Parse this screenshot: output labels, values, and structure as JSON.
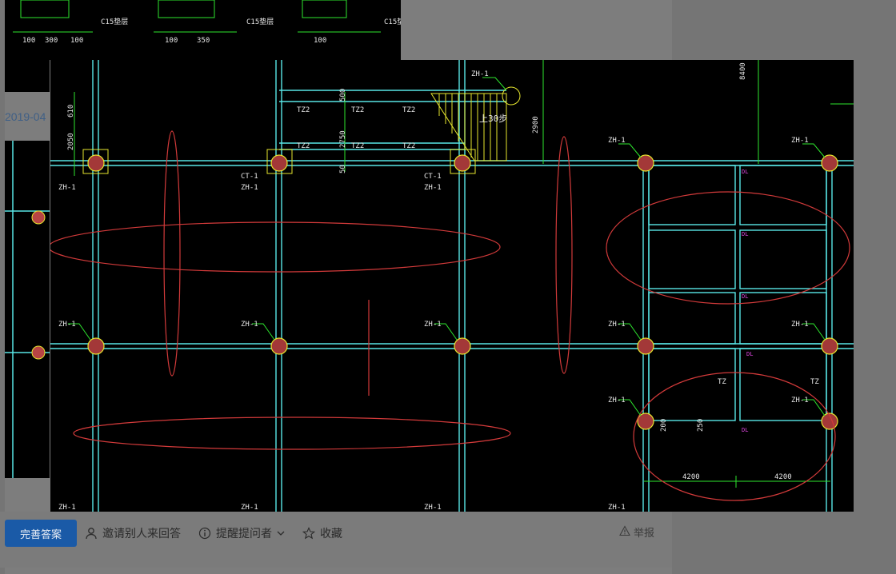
{
  "date_text": "2019-04",
  "actions": {
    "improve_answer": "完善答案",
    "invite_label": "邀请别人来回答",
    "remind_label": "提醒提问者",
    "favorite_label": "收藏",
    "report_label": "举报"
  },
  "drawing": {
    "labels": {
      "zh1": "ZH-1",
      "ct1": "CT-1",
      "tz2": "TZ2",
      "tz": "TZ",
      "c15": "C15垫层",
      "dim_4200": "4200",
      "dim_2900": "2900",
      "dim_2750": "2750",
      "dim_8400": "8400",
      "dim_200": "200",
      "dim_250": "250",
      "dim_2050": "2050",
      "dim_610": "610",
      "dim_50": "50",
      "dim_500": "500",
      "dim_100": "100",
      "dim_300": "300",
      "dim_350": "350",
      "stair": "上30步",
      "dl": "DL"
    }
  },
  "colors": {
    "cyan": "#58e6e6",
    "green": "#2ee62e",
    "yellow": "#e6e62e",
    "red": "#d23a3a",
    "magenta": "#e046e0",
    "brand_button": "#1a5aa7"
  }
}
